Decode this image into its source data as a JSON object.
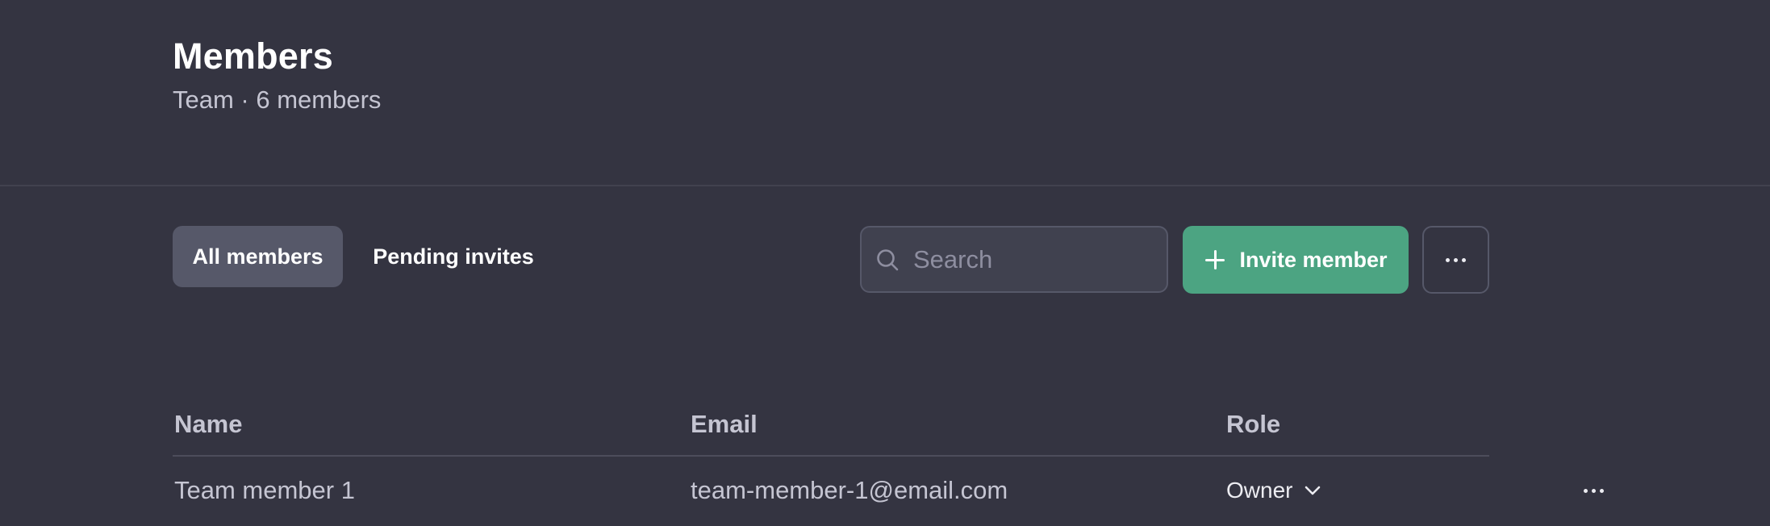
{
  "header": {
    "title": "Members",
    "subtitle": "Team · 6 members"
  },
  "tabs": [
    {
      "label": "All members",
      "active": true
    },
    {
      "label": "Pending invites",
      "active": false
    }
  ],
  "search": {
    "placeholder": "Search",
    "value": "",
    "icon": "search-icon"
  },
  "toolbar": {
    "invite_label": "Invite member",
    "invite_icon": "plus-icon",
    "more_icon": "more-horizontal-icon"
  },
  "table": {
    "columns": [
      "Name",
      "Email",
      "Role"
    ],
    "rows": [
      {
        "name": "Team member 1",
        "email": "team-member-1@email.com",
        "role": "Owner"
      }
    ]
  },
  "colors": {
    "background": "#343441",
    "accent": "#4ca482",
    "active_tab": "#565869"
  }
}
